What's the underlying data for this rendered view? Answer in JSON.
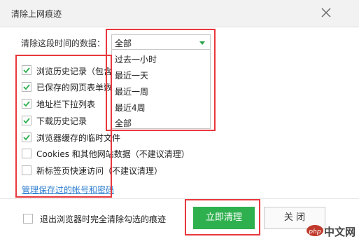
{
  "window": {
    "title": "清除上网痕迹"
  },
  "period": {
    "label": "清除这段时间的数据：",
    "selected": "全部",
    "options": [
      "过去一小时",
      "最近一天",
      "最近一周",
      "最近4周",
      "全部"
    ]
  },
  "items": [
    {
      "label": "浏览历史记录（包含",
      "checked": true
    },
    {
      "label": "已保存的网页表单数",
      "checked": true
    },
    {
      "label": "地址栏下拉列表",
      "checked": true
    },
    {
      "label": "下载历史记录",
      "checked": true
    },
    {
      "label": "浏览器缓存的临时文件",
      "checked": true
    },
    {
      "label": "Cookies 和其他网站数据（不建议清理）",
      "checked": false
    },
    {
      "label": "新标签页快速访问（不建议清理）",
      "checked": false
    }
  ],
  "manage_link": "管理保存过的帐号和密码",
  "footer": {
    "exit_clear_label": "退出浏览器时完全清除勾选的痕迹",
    "clear_button": "立即清理",
    "close_button": "关 闭"
  },
  "watermark": {
    "text": "中文网"
  },
  "colors": {
    "accent": "#2fb04f",
    "highlight": "#e8383d",
    "link": "#2e7fd0",
    "watermark": "#c0392b"
  }
}
